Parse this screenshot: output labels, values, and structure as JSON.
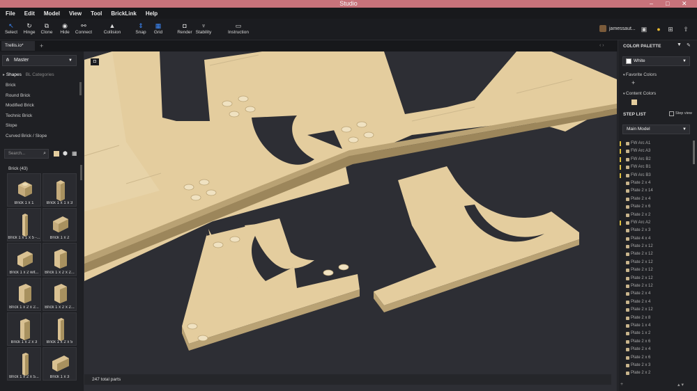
{
  "window": {
    "title": "Studio",
    "controls": [
      "–",
      "□",
      "✕"
    ]
  },
  "menu": [
    "File",
    "Edit",
    "Model",
    "View",
    "Tool",
    "BrickLink",
    "Help"
  ],
  "toolbar": [
    {
      "label": "Select",
      "icon": "select-icon",
      "glyph": "↖"
    },
    {
      "label": "Hinge",
      "icon": "hinge-icon",
      "glyph": "↻"
    },
    {
      "label": "Clone",
      "icon": "clone-icon",
      "glyph": "⧉"
    },
    {
      "label": "Hide",
      "icon": "eye-icon",
      "glyph": "◉"
    },
    {
      "label": "Connect",
      "icon": "connect-icon",
      "glyph": "⚯"
    },
    {
      "label": "Collision",
      "icon": "collision-icon",
      "glyph": "▲"
    },
    {
      "label": "Snap",
      "icon": "snap-icon",
      "glyph": "⇕"
    },
    {
      "label": "Grid",
      "icon": "grid-icon",
      "glyph": "▦"
    },
    {
      "label": "Render",
      "icon": "camera-icon",
      "glyph": "◘"
    },
    {
      "label": "Stability",
      "icon": "stability-icon",
      "glyph": "♆"
    },
    {
      "label": "Instruction",
      "icon": "instruction-icon",
      "glyph": "▭"
    }
  ],
  "user": {
    "name": "jamessaut..."
  },
  "tab": {
    "name": "Trellis.io*"
  },
  "left": {
    "master": "Master",
    "shape_tabs": [
      "Shapes",
      "BL Categories"
    ],
    "categories": [
      "Brick",
      "Round Brick",
      "Modified Brick",
      "Technic Brick",
      "Slope",
      "Curved Brick / Slope"
    ],
    "search_placeholder": "Search...",
    "group_label": "Brick (43)",
    "bricks": [
      "Brick 1 x 1",
      "Brick 1 x 1 x 3",
      "Brick 1 x 1 x 5 -...",
      "Brick 1 x 2",
      "Brick 1 x 2 wit...",
      "Brick 1 x 2 x 2...",
      "Brick 1 x 2 x 2...",
      "Brick 1 x 2 x 2...",
      "Brick 1 x 2 x 3",
      "Brick 1 x 2 x 5",
      "Brick 1 x 2 x 5...",
      "Brick 1 x 3"
    ]
  },
  "status": "247 total parts",
  "right": {
    "color_palette": "COLOR PALETTE",
    "color": "White",
    "favorite_colors": "Favorite Colors",
    "content_colors": "Content Colors",
    "step_list": "STEP LIST",
    "step_view": "Step view",
    "model": "Main Model",
    "steps": [
      "FW Arc A1",
      "FW Arc A3",
      "FW Arc B2",
      "FW Arc B1",
      "FW Arc B3",
      "Plate 2 x 4",
      "Plate 2 x 14",
      "Plate 2 x 4",
      "Plate 2 x 6",
      "Plate 2 x 2",
      "FW Arc A2",
      "Plate 2 x 3",
      "Plate 4 x 4",
      "Plate 2 x 12",
      "Plate 2 x 12",
      "Plate 2 x 12",
      "Plate 2 x 12",
      "Plate 2 x 12",
      "Plate 2 x 12",
      "Plate 2 x 4",
      "Plate 2 x 4",
      "Plate 2 x 12",
      "Plate 2 x 8",
      "Plate 1 x 4",
      "Plate 1 x 2",
      "Plate 2 x 6",
      "Plate 2 x 4",
      "Plate 2 x 6",
      "Plate 2 x 3",
      "Plate 2 x 2"
    ]
  },
  "colors": {
    "accent": "#2d6cdf",
    "tan": "#e4cd9e",
    "tan_dark": "#b9a274",
    "tan_shadow": "#8f7c56",
    "viewport": "#2d2e34",
    "titlebar": "#c8737b"
  }
}
